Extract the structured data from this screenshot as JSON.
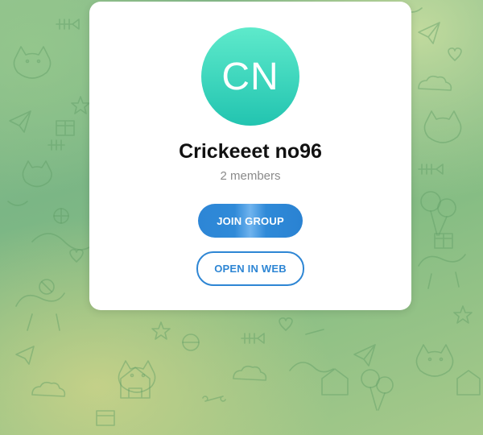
{
  "group": {
    "avatar_initials": "CN",
    "name": "Crickeeet no96",
    "members": "2 members"
  },
  "actions": {
    "join_label": "JOIN GROUP",
    "web_label": "OPEN IN WEB"
  },
  "colors": {
    "accent": "#2e86d4",
    "avatar_top": "#5eeacb",
    "avatar_bottom": "#22c4b0",
    "background": "#86bd84"
  },
  "background": {
    "pattern": "doodle-pattern"
  }
}
